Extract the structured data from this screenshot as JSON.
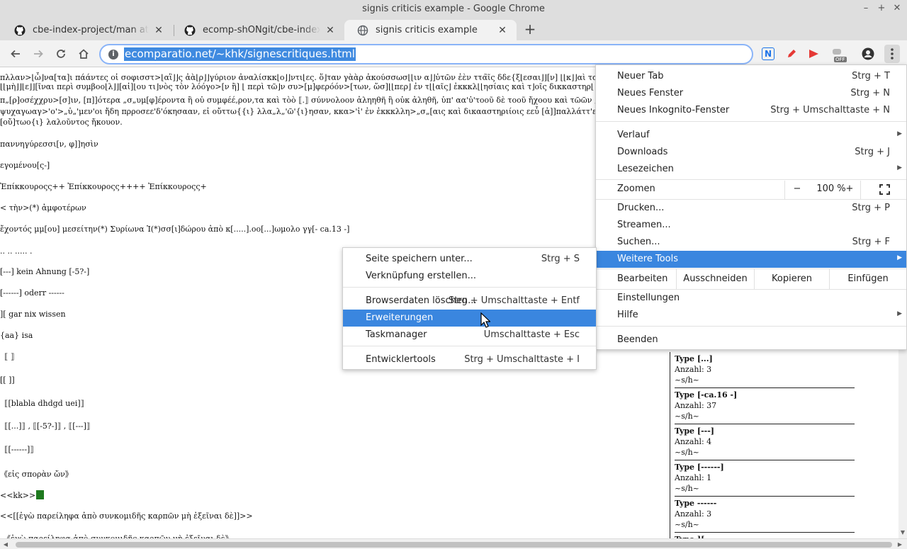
{
  "window": {
    "title": "signis criticis example - Google Chrome",
    "controls": [
      "–",
      "+",
      "✕"
    ]
  },
  "tabs": [
    {
      "label": "cbe-index-project/man at master",
      "icon": "github-icon"
    },
    {
      "label": "ecomp-shONgit/cbe-index-project",
      "icon": "github-icon"
    },
    {
      "label": "signis criticis example",
      "icon": "globe-icon",
      "active": true
    }
  ],
  "tab_close": "✕",
  "new_tab": "+",
  "toolbar": {
    "url": "ecomparatio.net/~khk/signescritiques.html",
    "info": "i",
    "ext_badge": "N",
    "ext_off": "OFF"
  },
  "content": {
    "top_lines": [
      "πλλαν>⌊ὦ⌋να[τα]ι πάάντες οἱ σοφισστ>⌊αἳ⌋⌋ς ἀὰ⌊ρ⌋⌋γύριον ἀναλίσκκ⌊ο⌋⌋ντι⌊ες. ὅ⌋ταν γὰὰρ ἀκούσσωσ⌊⌊ιν α⌋⌋ὐτῶν ἐὲν ττα̃ῖς δδε{ξ⌊εσαι⌋⌋[ν] ⌊⌊κ⌋⌋αὶ ταῖς π",
      "⌊⌊μὴ⌋⌋⌊ε⌋⌋[ῖναι περὶ συμβοο⌊λ⌋⌋[αἰ]⌊ου τι⌋νὸς τὸν λόόγο>[ν ἢ] ⌊ περὶ τῶ⌋ν συ>[μ]φερόόν>[των, ὥσ]⌊⌊περ⌋ ἐν τ⌊⌊αῖς⌋ ἐκκκλ⌊⌊ησίαις καὶ τ⌋οῖς δικκαστηρ⌊",
      "π„[ρ]οσέχχρυ>[σ]ιν, [π]]ότερα „σ„υμ[φ]έροντα ἢ οὐ συμφέέ,ρον,τα καὶ τὸὸ ⟦.⟧ σύννολοον ἀληηθῆ ἢ οὐκ ἀληθῆ, ὑπ' αα'ὐ'τοοῦ δὲ τοοῦ ἤχοου καὶ τῶῶν „π„εριό",
      "ψυχαγωαγ>'ο'>„ὐ„'μεν'οι ἤδη πρροσεε'δ'όκησααν, εἰ οὔττω{{ι} λλα„λ„'ῶ'{ι}ησαν, κκα>'ἰ' ἐν ἐκκκλλη>„σ„[αις καὶ δικααστηριίοις εεὖ [ἀ]]παλλάττ'ε'ι>'ν', οὐ συνορ",
      "[οὔ]τωο{ι} λαλοῦντος ἤκουον."
    ],
    "lines": [
      "παννηγύρεσσι[ν, φ]]ησὶν",
      "εγομένου[ς-]",
      "Ἐπίκκουροςς++ Ἐπίκκουροςς++++ Ἐπίκκουροςς+",
      "< τὴν>(*) ἀμφοτέρων",
      "ἔχοντός μμ[ου] μεσείτην(*) Συρίωνα Ἰ(*)σσ[ι]δώρου ἀπὸ κ[.....].οο[...]ωμολο γγ[- ca.13 -]",
      ".. .. ..... .",
      "[---] kein Ahnung [-5?-]",
      "[------] oderr ------",
      "][ gar nix wissen",
      "{aa} isa",
      "⟦ ⟧",
      "[[ ]]",
      "⟦[blabla dhdgd uei]⟧",
      "⟦[...]⟧ , ⟦[-5?-]⟧ , ⟦[---]⟧",
      "⟦[------]⟧",
      "《εἰς σπορὰν ὤν》",
      "<<kk>>",
      "<<[[ἐγὼ παρείληφα ἀπὸ συνκομιδῆς καρπῶν μὴ ἐξεῖναι δὲ]]>>",
      "《ἐγὼ παρείληφα ἀπὸ συνκομιδῆς καρπῶν μὴ ἐξεῖναι δὲ》"
    ],
    "type_boxes": [
      {
        "type": "Type [...]",
        "count": "Anzahl: 3",
        "suffix": "~s/h~"
      },
      {
        "type": "Type [-ca.16 -]",
        "count": "Anzahl: 37",
        "suffix": "~s/h~"
      },
      {
        "type": "Type [---]",
        "count": "Anzahl: 4",
        "suffix": "~s/h~"
      },
      {
        "type": "Type [------]",
        "count": "Anzahl: 1",
        "suffix": "~s/h~"
      },
      {
        "type": "Type ------",
        "count": "Anzahl: 3",
        "suffix": "~s/h~"
      },
      {
        "type": "Type ][",
        "count": "",
        "suffix": ""
      }
    ]
  },
  "menu": {
    "new_tab": {
      "label": "Neuer Tab",
      "shortcut": "Strg + T"
    },
    "new_window": {
      "label": "Neues Fenster",
      "shortcut": "Strg + N"
    },
    "incognito": {
      "label": "Neues Inkognito-Fenster",
      "shortcut": "Strg + Umschalttaste + N"
    },
    "history": {
      "label": "Verlauf"
    },
    "downloads": {
      "label": "Downloads",
      "shortcut": "Strg + J"
    },
    "bookmarks": {
      "label": "Lesezeichen"
    },
    "zoom": {
      "label": "Zoomen",
      "minus": "−",
      "value": "100 %",
      "plus": "+"
    },
    "print": {
      "label": "Drucken...",
      "shortcut": "Strg + P"
    },
    "cast": {
      "label": "Streamen..."
    },
    "find": {
      "label": "Suchen...",
      "shortcut": "Strg + F"
    },
    "more_tools": {
      "label": "Weitere Tools"
    },
    "edit": {
      "label": "Bearbeiten",
      "cut": "Ausschneiden",
      "copy": "Kopieren",
      "paste": "Einfügen"
    },
    "settings": {
      "label": "Einstellungen"
    },
    "help": {
      "label": "Hilfe"
    },
    "exit": {
      "label": "Beenden"
    }
  },
  "submenu": {
    "save_page": {
      "label": "Seite speichern unter...",
      "shortcut": "Strg + S"
    },
    "create_shortcut": {
      "label": "Verknüpfung erstellen..."
    },
    "clear_data": {
      "label": "Browserdaten löschen...",
      "shortcut": "Strg + Umschalttaste + Entf"
    },
    "extensions": {
      "label": "Erweiterungen"
    },
    "task_manager": {
      "label": "Taskmanager",
      "shortcut": "Umschalttaste + Esc"
    },
    "dev_tools": {
      "label": "Entwicklertools",
      "shortcut": "Strg + Umschalttaste + I"
    }
  },
  "colors": {
    "highlight": "#3a86df",
    "selection": "#3f8ae0",
    "cursor_block": "#1f7a1f"
  }
}
